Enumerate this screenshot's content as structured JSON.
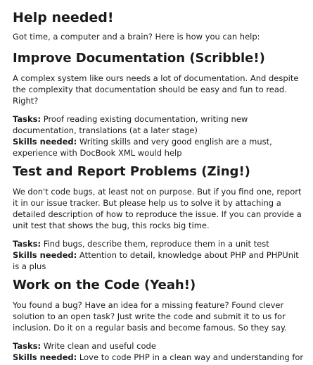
{
  "title": "Help needed!",
  "intro": "Got time, a computer and a brain? Here is how you can help:",
  "sections": [
    {
      "heading": "Improve Documentation (Scribble!)",
      "description": "A complex system like ours needs a lot of documentation. And despite the complexity that documentation should be easy and fun to read. Right?",
      "tasks_label": "Tasks:",
      "tasks": "Proof reading existing documentation, writing new documentation, translations (at a later stage)",
      "skills_label": "Skills needed:",
      "skills": "Writing skills and very good english are a must, experience with DocBook XML would help"
    },
    {
      "heading": "Test and Report Problems (Zing!)",
      "description": "We don't code bugs, at least not on purpose. But if you find one, report it in our issue tracker. But please help us to solve it by attaching a detailed description of how to reproduce the issue. If you can provide a unit test that shows the bug, this rocks big time.",
      "tasks_label": "Tasks:",
      "tasks": "Find bugs, describe them, reproduce them in a unit test",
      "skills_label": "Skills needed:",
      "skills": "Attention to detail, knowledge about PHP and PHPUnit is a plus"
    },
    {
      "heading": "Work on the Code (Yeah!)",
      "description": "You found a bug? Have an idea for a missing feature? Found clever solution to an open task? Just write the code and submit it to us for inclusion. Do it on a regular basis and become famous. So they say.",
      "tasks_label": "Tasks:",
      "tasks": "Write clean and useful code",
      "skills_label": "Skills needed:",
      "skills": "Love to code PHP in a clean way and understanding for"
    }
  ]
}
